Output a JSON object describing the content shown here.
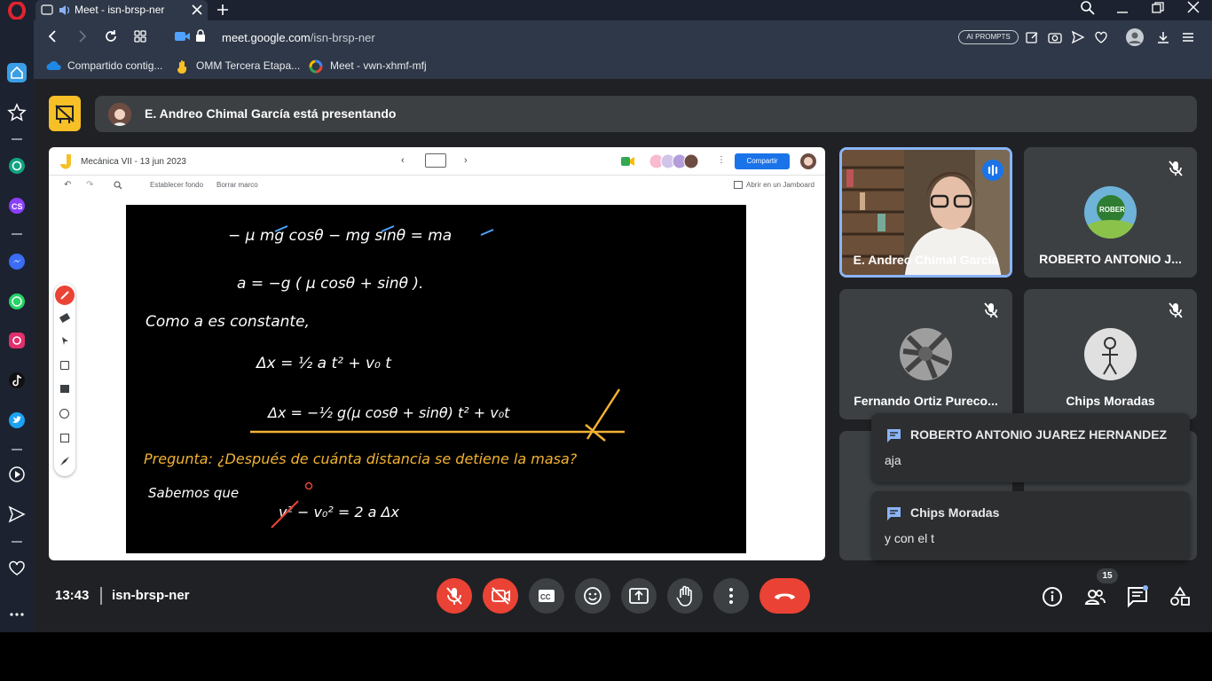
{
  "browser": {
    "tab_title": "Meet - isn-brsp-ner",
    "url_domain": "meet.google.com",
    "url_path": "/isn-brsp-ner",
    "ai_prompts_label": "AI PROMPTS",
    "bookmarks": [
      {
        "label": "Compartido contig...",
        "icon": "cloud-icon"
      },
      {
        "label": "OMM Tercera Etapa...",
        "icon": "hand-icon"
      },
      {
        "label": "Meet - vwn-xhmf-mfj",
        "icon": "google-icon"
      }
    ]
  },
  "presenting": {
    "label": "E. Andreo Chimal García está presentando"
  },
  "jamboard": {
    "title": "Mecánica VII - 13 jun 2023",
    "share_label": "Compartir",
    "set_background": "Establecer fondo",
    "clear_frame": "Borrar marco",
    "open_in_jamboard": "Abrir en un Jamboard",
    "handwriting": [
      "− μ mg cosθ − mg sinθ = ma",
      "a = −g ( μ cosθ + sinθ ).",
      "Como a es constante,",
      "Δx = ½ a t² + v₀ t",
      "Δx = −½ g(μ cosθ + sinθ) t² + v₀t",
      "Pregunta: ¿Después de cuánta distancia se detiene la masa?",
      "Sabemos que",
      "v² − v₀² = 2 a Δx"
    ]
  },
  "participants": [
    {
      "name": "E. Andreo Chimal García",
      "status": "speaking"
    },
    {
      "name": "ROBERTO ANTONIO J...",
      "status": "muted"
    },
    {
      "name": "Fernando Ortiz Pureco...",
      "status": "muted"
    },
    {
      "name": "Chips Moradas",
      "status": "muted"
    }
  ],
  "chat": [
    {
      "sender": "ROBERTO ANTONIO JUAREZ HERNANDEZ",
      "message": "aja"
    },
    {
      "sender": "Chips Moradas",
      "message": "y con el t"
    }
  ],
  "controls": {
    "time": "13:43",
    "meeting_code": "isn-brsp-ner",
    "people_count": "15"
  },
  "colors": {
    "accent": "#1a73e8",
    "danger": "#ea4335",
    "presenting": "#f6c026",
    "speaking_border": "#8ab4f8"
  }
}
